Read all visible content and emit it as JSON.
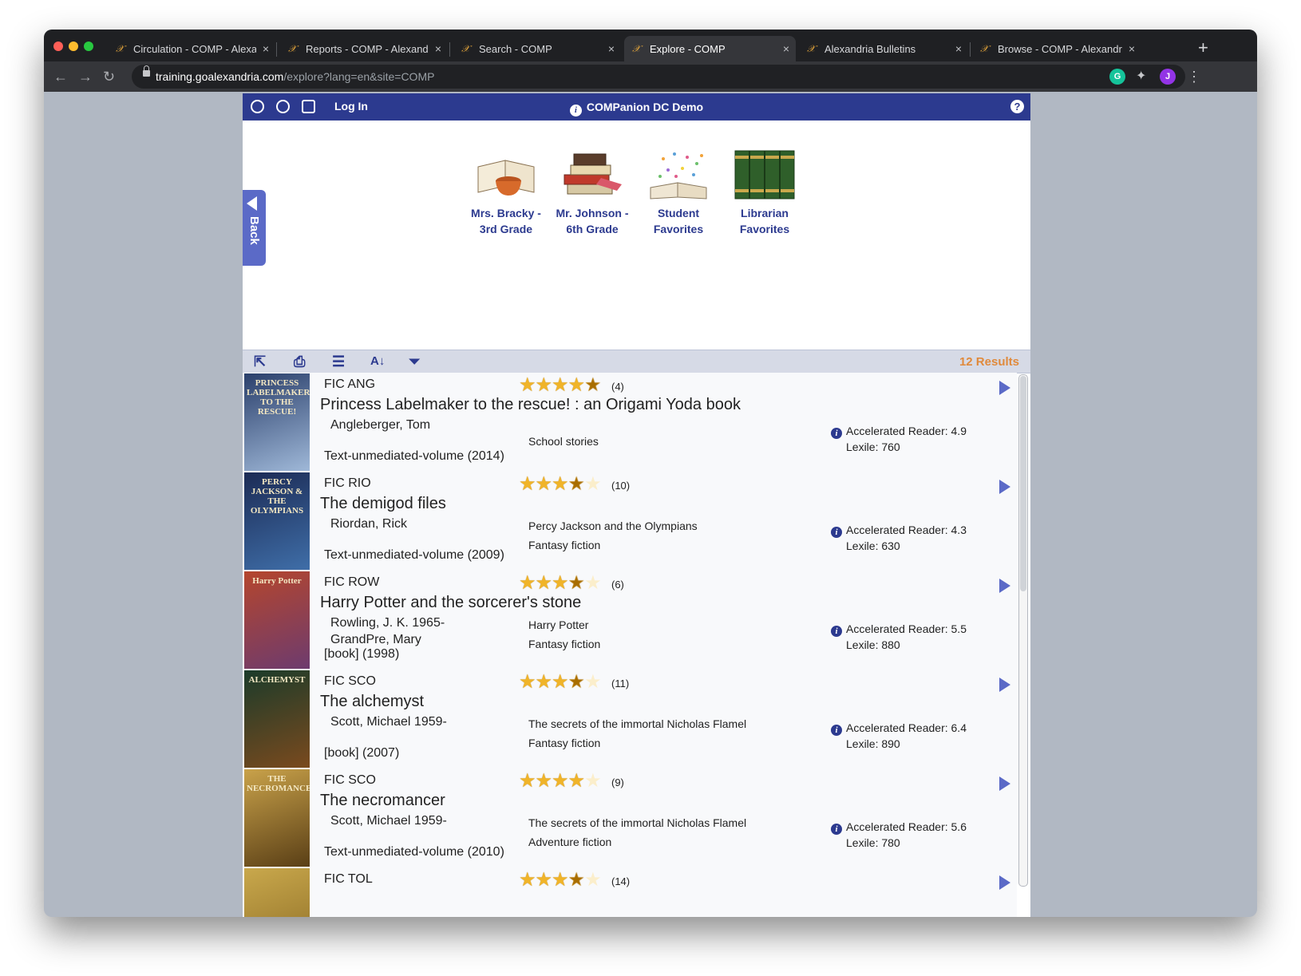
{
  "browser": {
    "tabs": [
      {
        "title": "Circulation - COMP - Alexandria",
        "active": false
      },
      {
        "title": "Reports - COMP - Alexandria",
        "active": false
      },
      {
        "title": "Search - COMP",
        "active": false
      },
      {
        "title": "Explore - COMP",
        "active": true
      },
      {
        "title": "Alexandria Bulletins",
        "active": false
      },
      {
        "title": "Browse - COMP - Alexandria",
        "active": false
      }
    ],
    "close_glyph": "×",
    "new_tab": "+",
    "url_host": "training.goalexandria.com",
    "url_rest": "/explore?lang=en&site=COMP",
    "profile_initial": "J",
    "extension_initial": "G"
  },
  "header": {
    "login": "Log In",
    "title": "COMPanion DC Demo"
  },
  "back_label": "Back",
  "shelves": [
    {
      "line1": "Mrs. Bracky -",
      "line2": "3rd Grade",
      "icon": "book-teacup-icon"
    },
    {
      "line1": "Mr. Johnson -",
      "line2": "6th Grade",
      "icon": "book-stack-icon"
    },
    {
      "line1": "Student",
      "line2": "Favorites",
      "icon": "open-book-sparkles-icon"
    },
    {
      "line1": "Librarian",
      "line2": "Favorites",
      "icon": "green-books-icon"
    }
  ],
  "results": {
    "count_label": "12 Results",
    "items": [
      {
        "call": "FIC ANG",
        "title": "Princess Labelmaker to the rescue! : an Origami Yoda book",
        "authors": [
          "Angleberger, Tom"
        ],
        "format": "Text-unmediated-volume (2014)",
        "rating": 4.5,
        "rating_count": "(4)",
        "subjects": [
          "School stories"
        ],
        "ar": "Accelerated Reader: 4.9",
        "lexile": "Lexile: 760",
        "cover_text": "PRINCESS LABELMAKER TO THE RESCUE!",
        "cover_colors": [
          "#2a3f6b",
          "#9fb8d8"
        ]
      },
      {
        "call": "FIC RIO",
        "title": "The demigod files",
        "authors": [
          "Riordan, Rick"
        ],
        "format": "Text-unmediated-volume (2009)",
        "rating": 3.5,
        "rating_count": "(10)",
        "subjects": [
          "Percy Jackson and the Olympians",
          "Fantasy fiction"
        ],
        "ar": "Accelerated Reader: 4.3",
        "lexile": "Lexile: 630",
        "cover_text": "PERCY JACKSON & THE OLYMPIANS",
        "cover_colors": [
          "#1c2b55",
          "#3f6ea8"
        ]
      },
      {
        "call": "FIC ROW",
        "title": "Harry Potter and the sorcerer's stone",
        "authors": [
          "Rowling, J. K. 1965-",
          "GrandPre, Mary"
        ],
        "format": "[book] (1998)",
        "rating": 3.5,
        "rating_count": "(6)",
        "subjects": [
          "Harry Potter",
          "Fantasy fiction"
        ],
        "ar": "Accelerated Reader: 5.5",
        "lexile": "Lexile: 880",
        "cover_text": "Harry Potter",
        "cover_colors": [
          "#b5462d",
          "#6d3b6e"
        ]
      },
      {
        "call": "FIC SCO",
        "title": "The alchemyst",
        "authors": [
          "Scott, Michael 1959-"
        ],
        "format": "[book] (2007)",
        "rating": 3.5,
        "rating_count": "(11)",
        "subjects": [
          "The secrets of the immortal Nicholas Flamel",
          "Fantasy fiction"
        ],
        "ar": "Accelerated Reader: 6.4",
        "lexile": "Lexile: 890",
        "cover_text": "ALCHEMYST",
        "cover_colors": [
          "#1b3b2a",
          "#7a4a1e"
        ]
      },
      {
        "call": "FIC SCO",
        "title": "The necromancer",
        "authors": [
          "Scott, Michael 1959-"
        ],
        "format": "Text-unmediated-volume (2010)",
        "rating": 4,
        "rating_count": "(9)",
        "subjects": [
          "The secrets of the immortal Nicholas Flamel",
          "Adventure fiction"
        ],
        "ar": "Accelerated Reader: 5.6",
        "lexile": "Lexile: 780",
        "cover_text": "THE NECROMANCER",
        "cover_colors": [
          "#c9a24a",
          "#5a3f16"
        ]
      },
      {
        "call": "FIC TOL",
        "title": "",
        "authors": [],
        "format": "",
        "rating": 3.5,
        "rating_count": "(14)",
        "subjects": [],
        "ar": "",
        "lexile": "",
        "cover_text": "",
        "cover_colors": [
          "#c9a84c",
          "#8a6a24"
        ]
      }
    ]
  }
}
